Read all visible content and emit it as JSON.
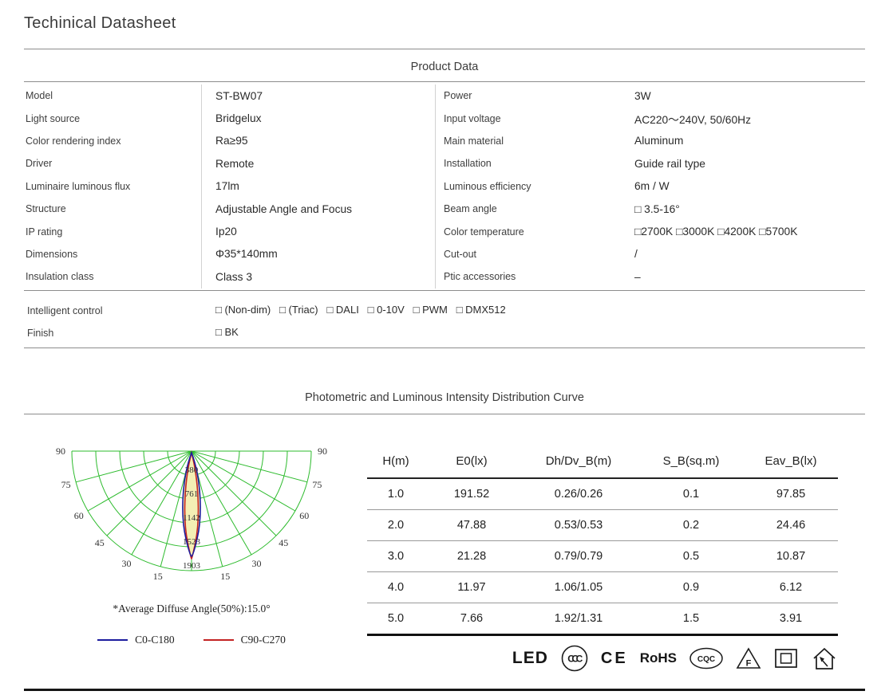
{
  "title": "Techinical Datasheet",
  "product": {
    "header": "Product Data",
    "left": [
      {
        "label": "Model",
        "value": "ST-BW07"
      },
      {
        "label": "Light source",
        "value": "Bridgelux"
      },
      {
        "label": "Color rendering index",
        "value": "Ra≥95"
      },
      {
        "label": "Driver",
        "value": "Remote"
      },
      {
        "label": "Luminaire luminous flux",
        "value": "17lm"
      },
      {
        "label": "Structure",
        "value": "Adjustable Angle and Focus"
      },
      {
        "label": "IP rating",
        "value": "Ip20"
      },
      {
        "label": "Dimensions",
        "value": "Φ35*140mm"
      },
      {
        "label": "Insulation class",
        "value": "Class 3"
      }
    ],
    "right": [
      {
        "label": "Power",
        "value": "3W"
      },
      {
        "label": "Input voltage",
        "value": "AC220～240V, 50/60Hz"
      },
      {
        "label": "Main material",
        "value": "Aluminum"
      },
      {
        "label": "Installation",
        "value": "Guide rail type"
      },
      {
        "label": "Luminous efficiency",
        "value": "6m / W"
      },
      {
        "label": "Beam angle",
        "value": "□ 3.5-16°"
      },
      {
        "label": "Color temperature",
        "value": "□2700K □3000K □4200K □5700K"
      },
      {
        "label": "Cut-out",
        "value": "/"
      },
      {
        "label": "Ptic accessories",
        "value": "–"
      }
    ],
    "controls": [
      {
        "label": "Intelligent control",
        "value": "□ (Non-dim)   □ (Triac)   □ DALI   □ 0-10V   □ PWM   □ DMX512"
      },
      {
        "label": "Finish",
        "value": "□ BK"
      }
    ]
  },
  "chart_data": {
    "type": "polar",
    "title": "Photometric and Luminous Intensity Distribution Curve",
    "series": [
      {
        "name": "C0-C180",
        "color": "#1c1c9e"
      },
      {
        "name": "C90-C270",
        "color": "#c32222"
      }
    ],
    "angle_ticks": [
      "90",
      "75",
      "60",
      "45",
      "30",
      "15"
    ],
    "ring_values": [
      "380",
      "761",
      "1142",
      "1523",
      "1903"
    ],
    "grid_color": "#2dbb2d",
    "beam_fill_color": "#f4efb4",
    "annotation": "*Average Diffuse Angle(50%):15.0°",
    "table": {
      "headers": [
        "H(m)",
        "E0(lx)",
        "Dh/Dv_B(m)",
        "S_B(sq.m)",
        "Eav_B(lx)"
      ],
      "rows": [
        [
          "1.0",
          "191.52",
          "0.26/0.26",
          "0.1",
          "97.85"
        ],
        [
          "2.0",
          "47.88",
          "0.53/0.53",
          "0.2",
          "24.46"
        ],
        [
          "3.0",
          "21.28",
          "0.79/0.79",
          "0.5",
          "10.87"
        ],
        [
          "4.0",
          "11.97",
          "1.06/1.05",
          "0.9",
          "6.12"
        ],
        [
          "5.0",
          "7.66",
          "1.92/1.31",
          "1.5",
          "3.91"
        ]
      ]
    }
  },
  "certifications": {
    "led": "LED",
    "ccc": "CCC",
    "ce": "CE",
    "rohs": "RoHS",
    "cqc": "CQC",
    "f": "F"
  }
}
